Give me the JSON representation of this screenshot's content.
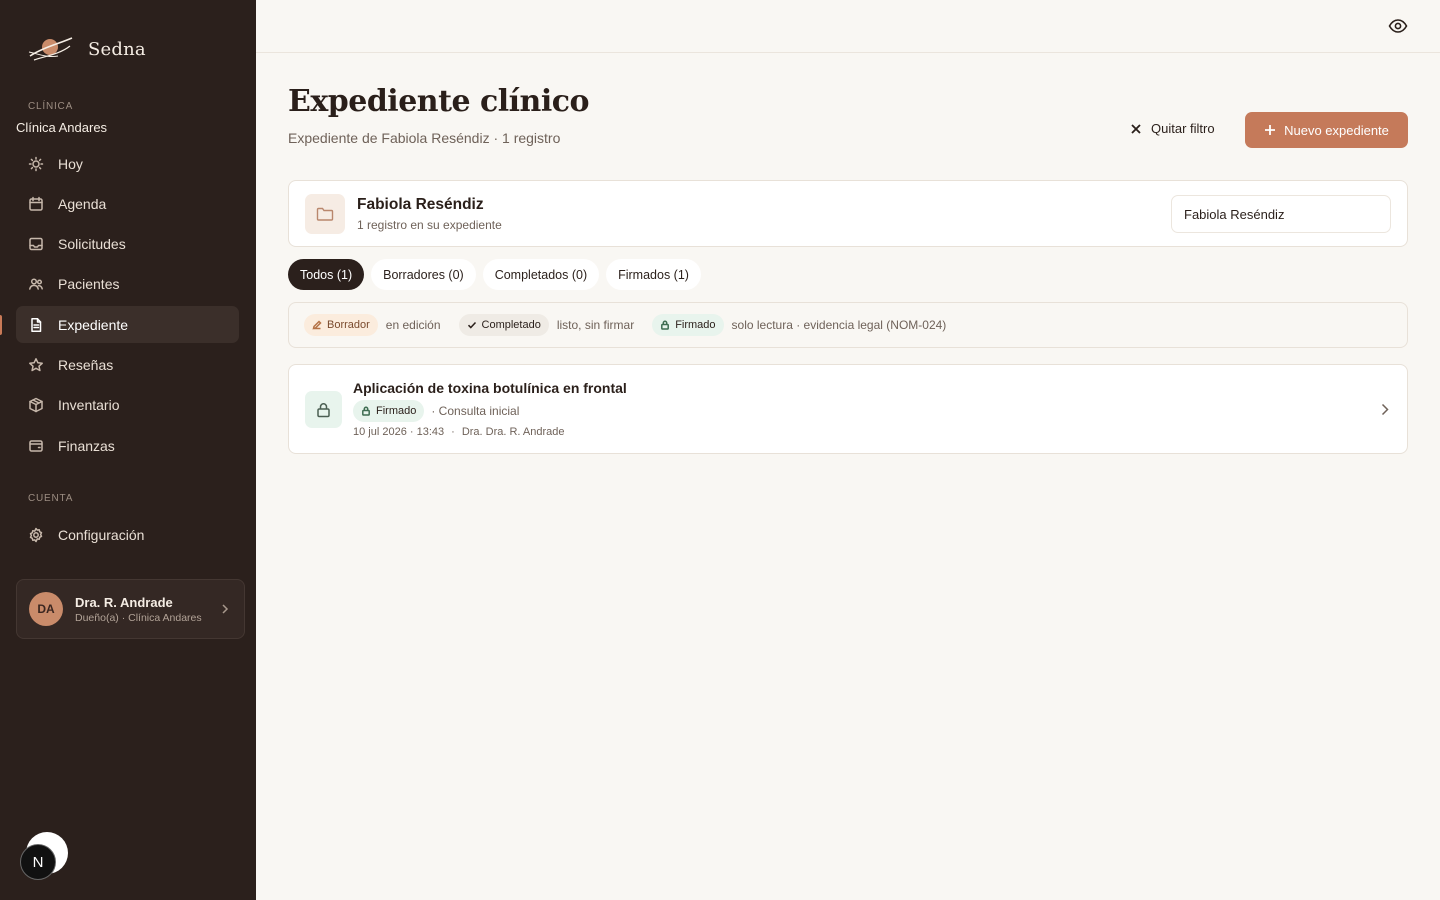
{
  "brand": {
    "name": "Sedna"
  },
  "sidebar": {
    "clinic_section_label": "CLÍNICA",
    "clinic_name": "Clínica Andares",
    "items": [
      {
        "label": "Hoy",
        "icon": "sun-icon"
      },
      {
        "label": "Agenda",
        "icon": "calendar-icon"
      },
      {
        "label": "Solicitudes",
        "icon": "inbox-icon"
      },
      {
        "label": "Pacientes",
        "icon": "users-icon"
      },
      {
        "label": "Expediente",
        "icon": "document-icon",
        "active": true
      },
      {
        "label": "Reseñas",
        "icon": "star-icon"
      },
      {
        "label": "Inventario",
        "icon": "box-icon"
      },
      {
        "label": "Finanzas",
        "icon": "wallet-icon"
      }
    ],
    "account_section_label": "CUENTA",
    "account_items": [
      {
        "label": "Configuración",
        "icon": "gear-icon"
      }
    ],
    "user": {
      "initials": "DA",
      "name": "Dra. R. Andrade",
      "role": "Dueño(a) · Clínica Andares"
    },
    "dev_badge": "N"
  },
  "header": {
    "title": "Expediente clínico",
    "subtitle": "Expediente de Fabiola Reséndiz · 1 registro",
    "clear_filter_label": "Quitar filtro",
    "new_record_label": "Nuevo expediente"
  },
  "patient": {
    "name": "Fabiola Reséndiz",
    "count_text": "1 registro en su expediente",
    "search_value": "Fabiola Reséndiz"
  },
  "tabs": [
    {
      "label": "Todos (1)",
      "active": true
    },
    {
      "label": "Borradores (0)"
    },
    {
      "label": "Completados (0)"
    },
    {
      "label": "Firmados (1)"
    }
  ],
  "legend": {
    "draft_label": "Borrador",
    "draft_desc": "en edición",
    "done_label": "Completado",
    "done_desc": "listo, sin firmar",
    "signed_label": "Firmado",
    "signed_desc": "solo lectura · evidencia legal (NOM-024)"
  },
  "records": [
    {
      "title": "Aplicación de toxina botulínica en frontal",
      "status": "Firmado",
      "type": "· Consulta inicial",
      "date": "10 jul 2026 · 13:43",
      "separator": "·",
      "doctor": "Dra. Dra. R. Andrade"
    }
  ],
  "colors": {
    "sidebar_bg": "#2b201c",
    "accent": "#c57a5a",
    "page_bg": "#f9f7f3",
    "signed_bg": "#e8f4ed",
    "draft_bg": "#fbecdd"
  }
}
